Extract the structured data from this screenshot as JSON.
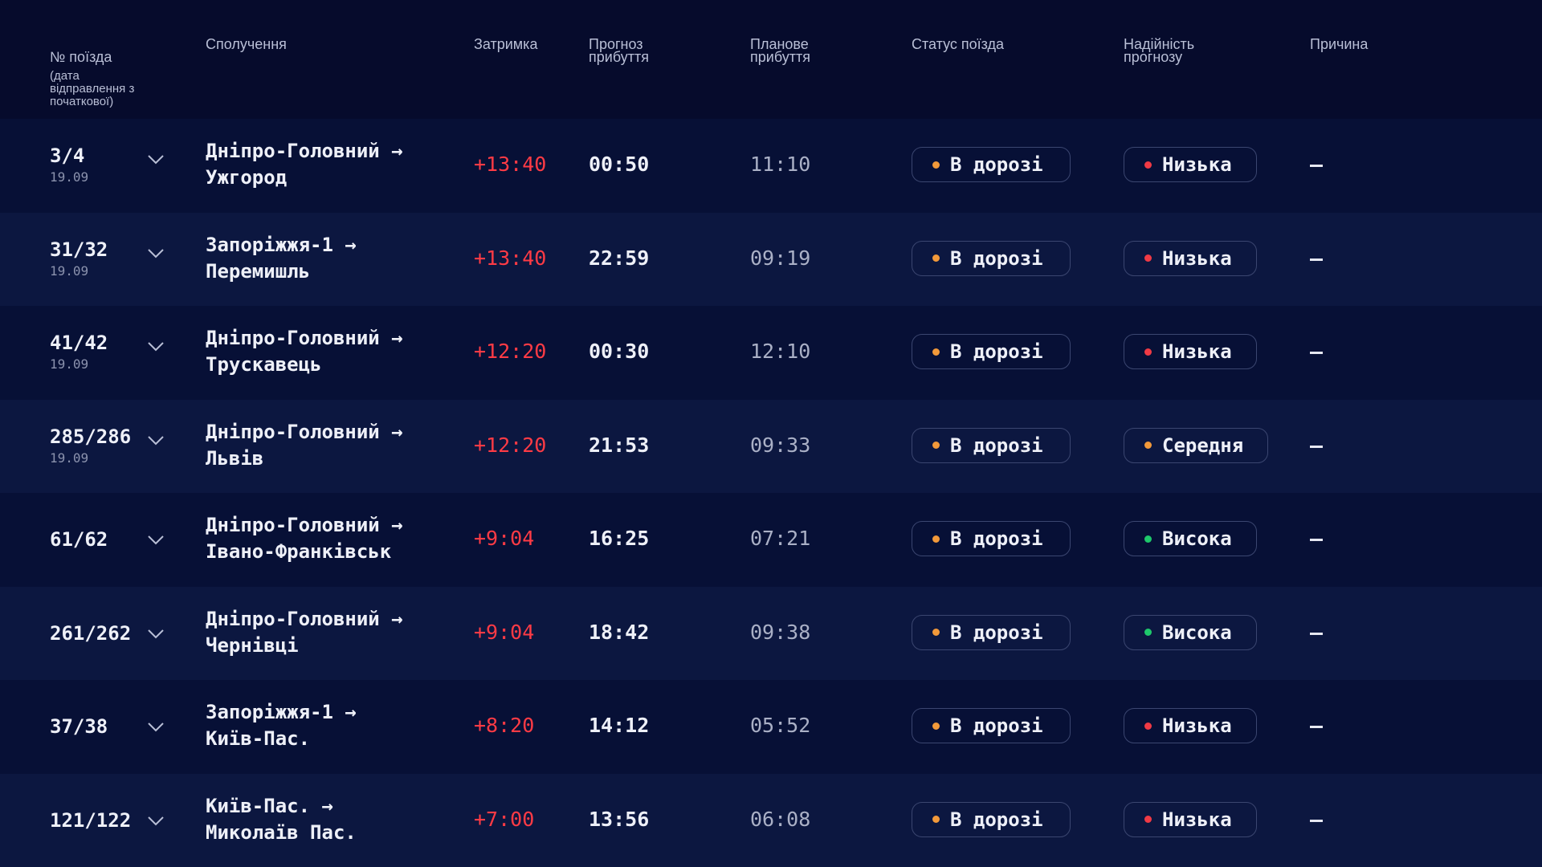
{
  "header": {
    "train_no": "№ поїзда",
    "train_no_sub": "(дата\nвідправлення з\nпочаткової)",
    "route": "Сполучення",
    "delay": "Затримка",
    "forecast": "Прогноз\nприбуття",
    "planned": "Планове\nприбуття",
    "status": "Статус поїзда",
    "reliability": "Надійність\nпрогнозу",
    "cause": "Причина"
  },
  "colors": {
    "background": "#060b2c",
    "row_odd": "#071036",
    "row_even": "#0c1740",
    "delay_red": "#ff3b45",
    "dot_orange": "#f2993a",
    "dot_red": "#f03a45",
    "dot_green": "#1ec86b"
  },
  "icons": {
    "expand": "chevron-down-icon",
    "status_dot": "dot-icon"
  },
  "rows": [
    {
      "number": "3/4",
      "date": "19.09",
      "from": "Дніпро-Головний →",
      "to": "Ужгород",
      "delay": "+13:40",
      "forecast": "00:50",
      "planned": "11:10",
      "status": "В дорозі",
      "status_color": "#f2993a",
      "reliability": "Низька",
      "reliability_color": "#f03a45",
      "cause": "—"
    },
    {
      "number": "31/32",
      "date": "19.09",
      "from": "Запоріжжя-1 →",
      "to": "Перемишль",
      "delay": "+13:40",
      "forecast": "22:59",
      "planned": "09:19",
      "status": "В дорозі",
      "status_color": "#f2993a",
      "reliability": "Низька",
      "reliability_color": "#f03a45",
      "cause": "—"
    },
    {
      "number": "41/42",
      "date": "19.09",
      "from": "Дніпро-Головний →",
      "to": "Трускавець",
      "delay": "+12:20",
      "forecast": "00:30",
      "planned": "12:10",
      "status": "В дорозі",
      "status_color": "#f2993a",
      "reliability": "Низька",
      "reliability_color": "#f03a45",
      "cause": "—"
    },
    {
      "number": "285/286",
      "date": "19.09",
      "from": "Дніпро-Головний →",
      "to": "Львів",
      "delay": "+12:20",
      "forecast": "21:53",
      "planned": "09:33",
      "status": "В дорозі",
      "status_color": "#f2993a",
      "reliability": "Середня",
      "reliability_color": "#f2993a",
      "cause": "—"
    },
    {
      "number": "61/62",
      "date": "",
      "from": "Дніпро-Головний →",
      "to": "Івано-Франківськ",
      "delay": "+9:04",
      "forecast": "16:25",
      "planned": "07:21",
      "status": "В дорозі",
      "status_color": "#f2993a",
      "reliability": "Висока",
      "reliability_color": "#1ec86b",
      "cause": "—"
    },
    {
      "number": "261/262",
      "date": "",
      "from": "Дніпро-Головний →",
      "to": "Чернівці",
      "delay": "+9:04",
      "forecast": "18:42",
      "planned": "09:38",
      "status": "В дорозі",
      "status_color": "#f2993a",
      "reliability": "Висока",
      "reliability_color": "#1ec86b",
      "cause": "—"
    },
    {
      "number": "37/38",
      "date": "",
      "from": "Запоріжжя-1 →",
      "to": "Київ-Пас.",
      "delay": "+8:20",
      "forecast": "14:12",
      "planned": "05:52",
      "status": "В дорозі",
      "status_color": "#f2993a",
      "reliability": "Низька",
      "reliability_color": "#f03a45",
      "cause": "—"
    },
    {
      "number": "121/122",
      "date": "",
      "from": "Київ-Пас. →",
      "to": "Миколаїв Пас.",
      "delay": "+7:00",
      "forecast": "13:56",
      "planned": "06:08",
      "status": "В дорозі",
      "status_color": "#f2993a",
      "reliability": "Низька",
      "reliability_color": "#f03a45",
      "cause": "—"
    }
  ]
}
